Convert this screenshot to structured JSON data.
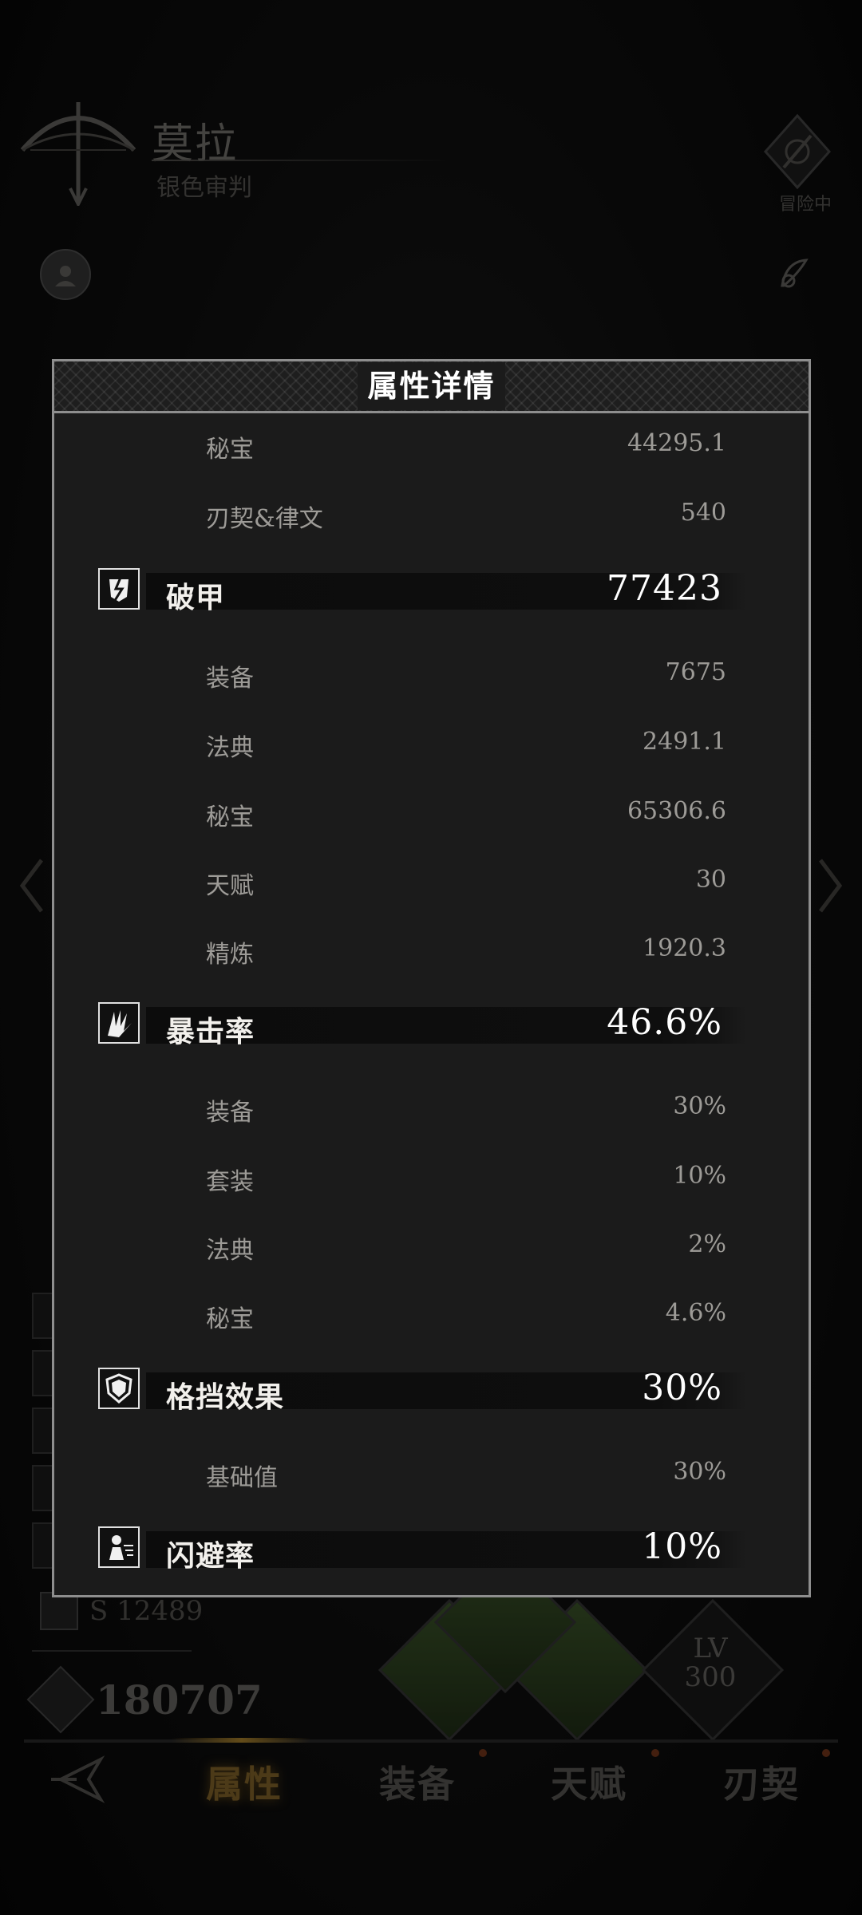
{
  "background": {
    "character_name": "莫拉",
    "character_subtitle": "银色审判",
    "top_right_badge_label": "冒险中",
    "power_small": "S 12489",
    "power_total": "180707",
    "skill_level": "LV\n300"
  },
  "nav": {
    "items": [
      {
        "label": "属性",
        "active": true
      },
      {
        "label": "装备",
        "active": false
      },
      {
        "label": "天赋",
        "active": false
      },
      {
        "label": "刃契",
        "active": false
      }
    ]
  },
  "modal": {
    "title": "属性详情",
    "rows": [
      {
        "kind": "sub",
        "label": "秘宝",
        "value": "44295.1"
      },
      {
        "kind": "sub",
        "label": "刃契&律文",
        "value": "540"
      },
      {
        "kind": "main",
        "icon": "armor-break-icon",
        "label": "破甲",
        "value": "77423"
      },
      {
        "kind": "sub",
        "label": "装备",
        "value": "7675"
      },
      {
        "kind": "sub",
        "label": "法典",
        "value": "2491.1"
      },
      {
        "kind": "sub",
        "label": "秘宝",
        "value": "65306.6"
      },
      {
        "kind": "sub",
        "label": "天赋",
        "value": "30"
      },
      {
        "kind": "sub",
        "label": "精炼",
        "value": "1920.3"
      },
      {
        "kind": "main",
        "icon": "crit-rate-icon",
        "label": "暴击率",
        "value": "46.6%"
      },
      {
        "kind": "sub",
        "label": "装备",
        "value": "30%"
      },
      {
        "kind": "sub",
        "label": "套装",
        "value": "10%"
      },
      {
        "kind": "sub",
        "label": "法典",
        "value": "2%"
      },
      {
        "kind": "sub",
        "label": "秘宝",
        "value": "4.6%"
      },
      {
        "kind": "main",
        "icon": "shield-icon",
        "label": "格挡效果",
        "value": "30%"
      },
      {
        "kind": "sub",
        "label": "基础值",
        "value": "30%"
      },
      {
        "kind": "main",
        "icon": "dodge-icon",
        "label": "闪避率",
        "value": "10%"
      }
    ]
  },
  "colors": {
    "accent_gold": "#b58a2e",
    "modal_border": "#8e8e8e",
    "skill_green": "#3f5a2c"
  }
}
